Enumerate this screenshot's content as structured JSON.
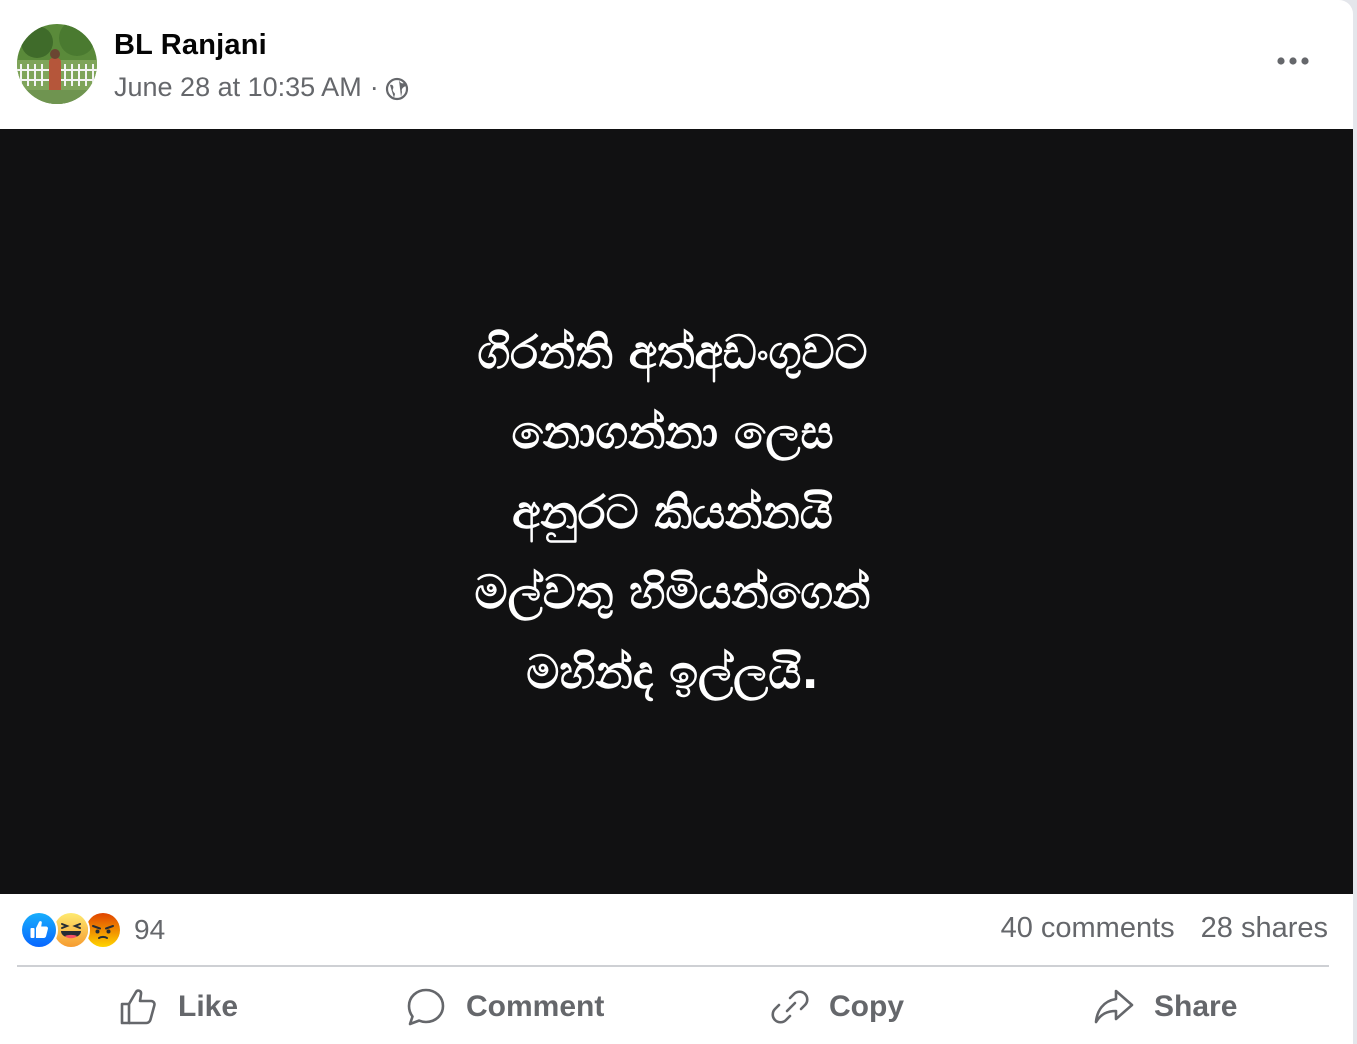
{
  "post": {
    "author": "BL Ranjani",
    "timestamp": "June 28 at 10:35 AM",
    "separator": "·",
    "privacy_icon": "globe-icon",
    "more_icon": "more-options-icon",
    "image_text_lines": [
      "ගිරන්ති අත්අඩංගුවට",
      "නොගන්නා ලෙස",
      "අනුරට කියන්නයි",
      "මල්වතු හිමියන්ගෙන්",
      "මහින්ද ඉල්ලයි."
    ],
    "image_background": "#111112"
  },
  "engagement": {
    "reaction_icons": [
      "like-reaction-icon",
      "haha-reaction-icon",
      "angry-reaction-icon"
    ],
    "reaction_count": "94",
    "comments": "40 comments",
    "shares": "28 shares"
  },
  "actions": {
    "like_label": "Like",
    "comment_label": "Comment",
    "copy_label": "Copy",
    "share_label": "Share"
  },
  "colors": {
    "like_blue": "#1877f2",
    "haha_yellow": "#f7b125",
    "angry_red": "#e9710f",
    "secondary_text": "#65676b"
  }
}
